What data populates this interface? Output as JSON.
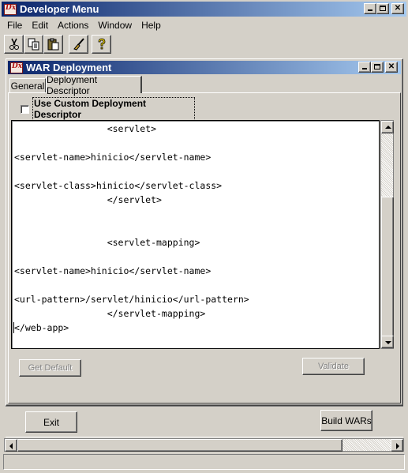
{
  "main_window": {
    "title": "Developer Menu",
    "menu": [
      "File",
      "Edit",
      "Actions",
      "Window",
      "Help"
    ],
    "toolbar": [
      "cut",
      "copy",
      "paste",
      "clean",
      "help"
    ]
  },
  "inner_window": {
    "title": "WAR Deployment",
    "tabs": [
      "General",
      "Deployment Descriptor"
    ],
    "active_tab": "Deployment Descriptor",
    "checkbox": {
      "label": "Use Custom Deployment Descriptor",
      "checked": false
    },
    "code_lines": [
      "                 <servlet>",
      "",
      "<servlet-name>hinicio</servlet-name>",
      "",
      "<servlet-class>hinicio</servlet-class>",
      "                 </servlet>",
      "",
      "",
      "                 <servlet-mapping>",
      "",
      "<servlet-name>hinicio</servlet-name>",
      "",
      "<url-pattern>/servlet/hinicio</url-pattern>",
      "                 </servlet-mapping>",
      "</web-app>"
    ],
    "buttons": {
      "get_default": "Get Default",
      "validate": "Validate",
      "exit": "Exit",
      "build_wars": "Build WARs"
    }
  }
}
